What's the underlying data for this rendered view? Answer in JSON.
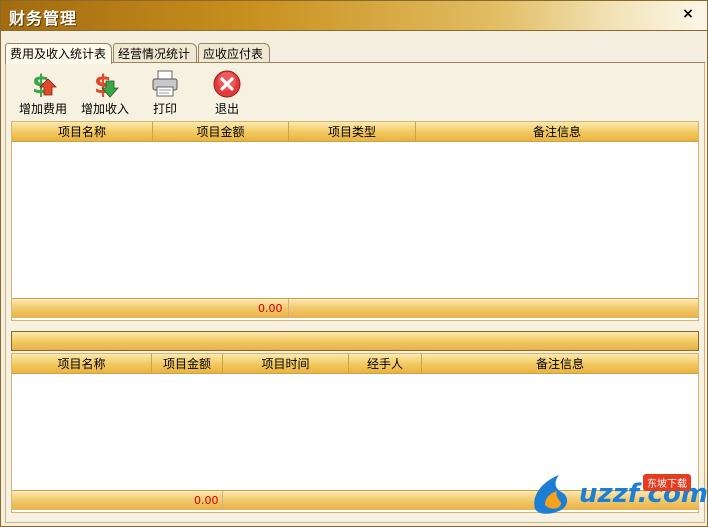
{
  "window": {
    "title": "财务管理",
    "close_symbol": "×"
  },
  "tabs": [
    {
      "label": "费用及收入统计表",
      "active": true
    },
    {
      "label": "经营情况统计",
      "active": false
    },
    {
      "label": "应收应付表",
      "active": false
    }
  ],
  "toolbar": {
    "add_expense": "增加费用",
    "add_income": "增加收入",
    "print": "打印",
    "exit": "退出"
  },
  "grid_top": {
    "columns": [
      "项目名称",
      "项目金额",
      "项目类型",
      "备注信息"
    ],
    "rows": [],
    "total": "0.00"
  },
  "grid_bottom": {
    "columns": [
      "项目名称",
      "项目金额",
      "项目时间",
      "经手人",
      "备注信息"
    ],
    "rows": [],
    "total": "0.00"
  },
  "watermark": {
    "text": "uzzf.com",
    "tag": "东坡下载"
  },
  "colors": {
    "accent": "#f2c85e",
    "total_text": "#d00000",
    "title_bar": "#c8901e"
  }
}
